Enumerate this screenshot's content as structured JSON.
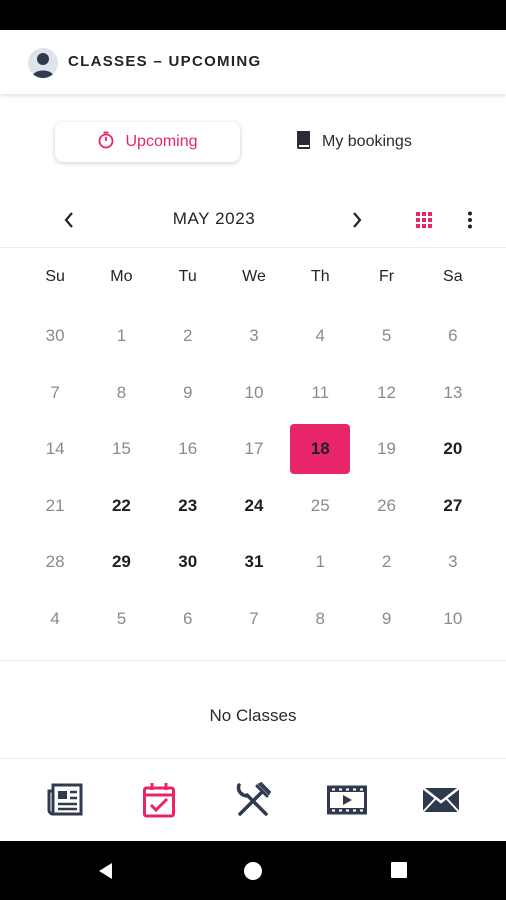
{
  "header": {
    "title": "CLASSES – UPCOMING",
    "avatar_icon": "user-avatar-icon"
  },
  "tabs": [
    {
      "label": "Upcoming",
      "icon": "stopwatch-icon",
      "active": true
    },
    {
      "label": "My bookings",
      "icon": "book-icon",
      "active": false
    }
  ],
  "calendar": {
    "month_label": "MAY 2023",
    "weekdays": [
      "Su",
      "Mo",
      "Tu",
      "We",
      "Th",
      "Fr",
      "Sa"
    ],
    "weeks": [
      [
        "30",
        "1",
        "2",
        "3",
        "4",
        "5",
        "6"
      ],
      [
        "7",
        "8",
        "9",
        "10",
        "11",
        "12",
        "13"
      ],
      [
        "14",
        "15",
        "16",
        "17",
        "18",
        "19",
        "20"
      ],
      [
        "21",
        "22",
        "23",
        "24",
        "25",
        "26",
        "27"
      ],
      [
        "28",
        "29",
        "30",
        "31",
        "1",
        "2",
        "3"
      ],
      [
        "4",
        "5",
        "6",
        "7",
        "8",
        "9",
        "10"
      ]
    ],
    "selected_day": "18",
    "bold_days_in_month": [
      "20",
      "22",
      "23",
      "24",
      "27",
      "29",
      "30",
      "31"
    ]
  },
  "empty_state": "No Classes",
  "bottom_nav": [
    "news-icon",
    "calendar-check-icon",
    "utensils-icon",
    "video-icon",
    "mail-icon"
  ],
  "colors": {
    "accent": "#e8246a",
    "text": "#1e1e22",
    "muted": "#8a8a90"
  }
}
